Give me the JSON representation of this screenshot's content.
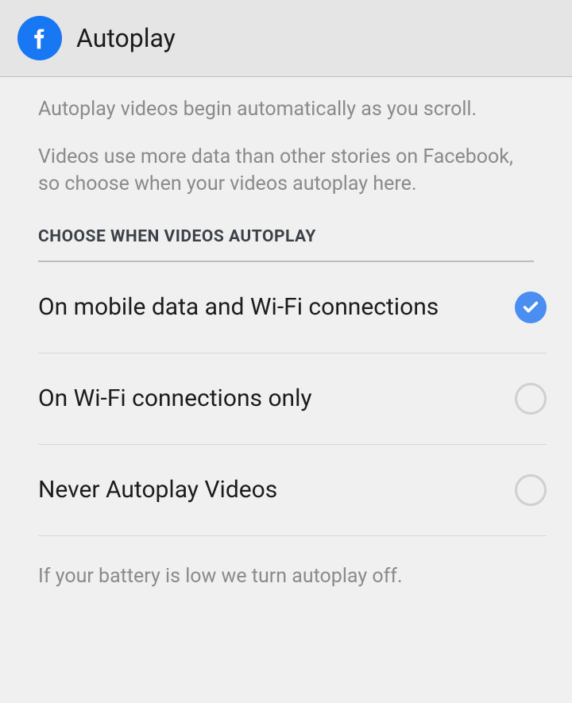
{
  "header": {
    "title": "Autoplay"
  },
  "description": {
    "line1": "Autoplay videos begin automatically as you scroll.",
    "line2": "Videos use more data than other stories on Facebook, so choose when your videos autoplay here."
  },
  "section_title": "CHOOSE WHEN VIDEOS AUTOPLAY",
  "options": [
    {
      "label": "On mobile data and Wi-Fi connections",
      "selected": true
    },
    {
      "label": "On Wi-Fi connections only",
      "selected": false
    },
    {
      "label": "Never Autoplay Videos",
      "selected": false
    }
  ],
  "footer_note": "If your battery is low we turn autoplay off."
}
